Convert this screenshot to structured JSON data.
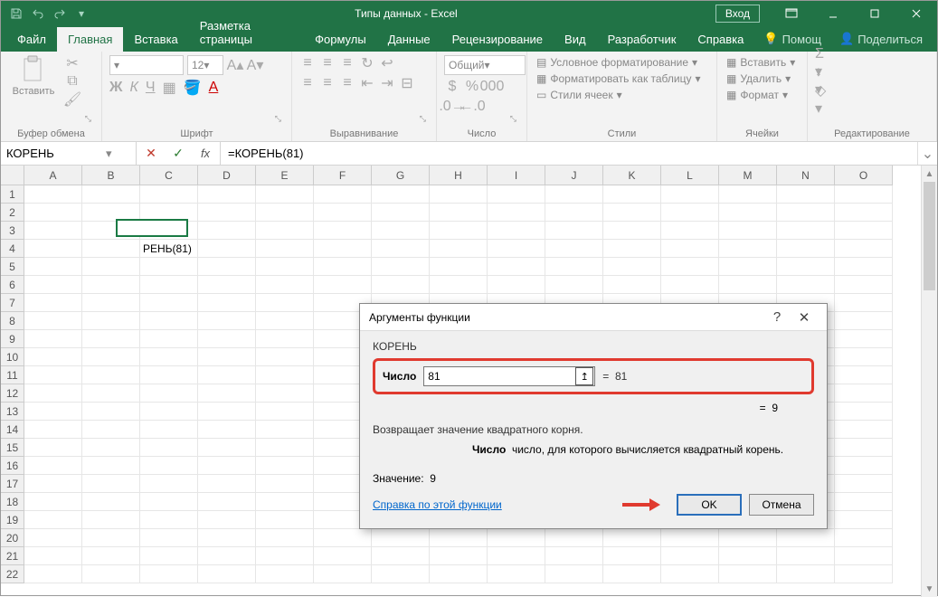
{
  "titlebar": {
    "title": "Типы данных  -  Excel",
    "login": "Вход"
  },
  "tabs": {
    "file": "Файл",
    "home": "Главная",
    "insert": "Вставка",
    "layout": "Разметка страницы",
    "formulas": "Формулы",
    "data": "Данные",
    "review": "Рецензирование",
    "view": "Вид",
    "developer": "Разработчик",
    "help": "Справка",
    "tellme": "Помощ",
    "share": "Поделиться"
  },
  "ribbon": {
    "clipboard": {
      "label": "Буфер обмена",
      "paste": "Вставить"
    },
    "font": {
      "label": "Шрифт",
      "size": "12",
      "bold": "Ж",
      "italic": "К",
      "underline": "Ч"
    },
    "align": {
      "label": "Выравнивание"
    },
    "number": {
      "label": "Число",
      "format": "Общий"
    },
    "styles": {
      "label": "Стили",
      "cond": "Условное форматирование",
      "table": "Форматировать как таблицу",
      "cell": "Стили ячеек"
    },
    "cells": {
      "label": "Ячейки",
      "insert": "Вставить",
      "delete": "Удалить",
      "format": "Формат"
    },
    "editing": {
      "label": "Редактирование"
    }
  },
  "formula_bar": {
    "name_box": "КОРЕНЬ",
    "formula": "=КОРЕНЬ(81)"
  },
  "columns": [
    "A",
    "B",
    "C",
    "D",
    "E",
    "F",
    "G",
    "H",
    "I",
    "J",
    "K",
    "L",
    "M",
    "N",
    "O"
  ],
  "active_cell": {
    "col": 2,
    "row": 3,
    "display": "РЕНЬ(81)"
  },
  "dialog": {
    "title": "Аргументы функции",
    "fn": "КОРЕНЬ",
    "arg_label": "Число",
    "arg_value": "81",
    "arg_eval": "81",
    "result_preview": "9",
    "desc": "Возвращает значение квадратного корня.",
    "arg_name": "Число",
    "arg_desc": "число, для которого вычисляется квадратный корень.",
    "value_label": "Значение:",
    "value": "9",
    "help": "Справка по этой функции",
    "ok": "OK",
    "cancel": "Отмена",
    "help_icon": "?",
    "close_icon": "✕",
    "eq": "="
  }
}
